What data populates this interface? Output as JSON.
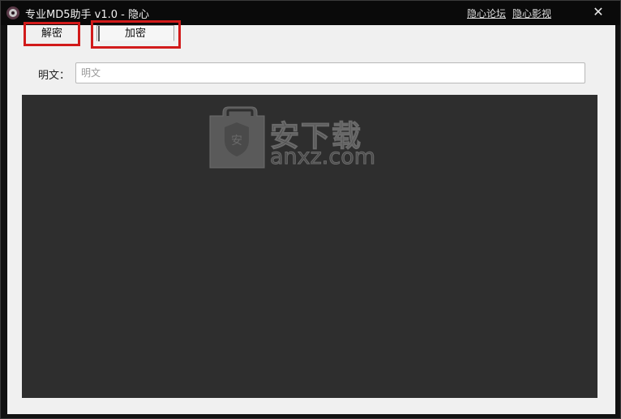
{
  "window": {
    "title": "专业MD5助手 v1.0 - 隐心",
    "links": [
      "隐心论坛",
      "隐心影视"
    ],
    "close_glyph": "✕"
  },
  "tabs": {
    "decrypt_label": "解密",
    "encrypt_label": "加密"
  },
  "form": {
    "plaintext_label": "明文：",
    "plaintext_placeholder": "明文",
    "plaintext_value": ""
  },
  "watermark": {
    "cn": "安下载",
    "en": "anxz.com",
    "icon": "shield-bag-icon"
  },
  "colors": {
    "highlight_box": "#d11a1a",
    "output_bg": "#2e2e2e",
    "client_bg": "#f0f0f0"
  }
}
